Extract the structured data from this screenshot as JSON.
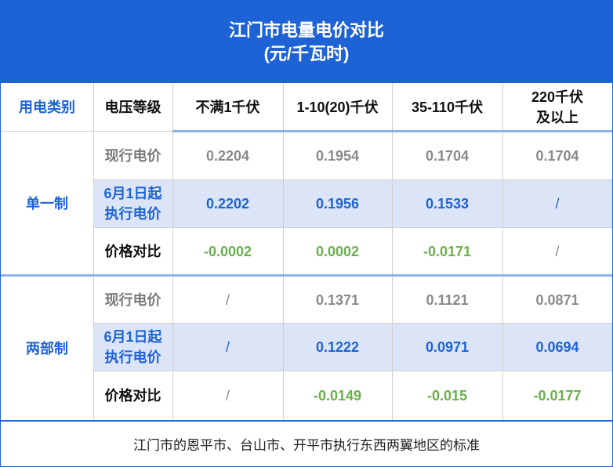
{
  "title": {
    "line1": "江门市电量电价对比",
    "line2": "(元/千瓦时)"
  },
  "header": {
    "category": "用电类别",
    "voltage": "电压等级",
    "col1": "不满1千伏",
    "col2": "1-10(20)千伏",
    "col3": "35-110千伏",
    "col4_line1": "220千伏",
    "col4_line2": "及以上"
  },
  "groups": [
    {
      "name": "单一制",
      "rows": [
        {
          "label": "现行电价",
          "values": [
            "0.2204",
            "0.1954",
            "0.1704",
            "0.1704"
          ]
        },
        {
          "label_line1": "6月1日起",
          "label_line2": "执行电价",
          "values": [
            "0.2202",
            "0.1956",
            "0.1533",
            "/"
          ]
        },
        {
          "label": "价格对比",
          "values": [
            "-0.0002",
            "0.0002",
            "-0.0171",
            "/"
          ]
        }
      ]
    },
    {
      "name": "两部制",
      "rows": [
        {
          "label": "现行电价",
          "values": [
            "/",
            "0.1371",
            "0.1121",
            "0.0871"
          ]
        },
        {
          "label_line1": "6月1日起",
          "label_line2": "执行电价",
          "values": [
            "/",
            "0.1222",
            "0.0971",
            "0.0694"
          ]
        },
        {
          "label": "价格对比",
          "values": [
            "/",
            "-0.0149",
            "-0.015",
            "-0.0177"
          ]
        }
      ]
    }
  ],
  "footer": "江门市的恩平市、台山市、开平市执行东西两翼地区的标准",
  "colors": {
    "brand_blue": "#1e63d6",
    "band": "#dbe5f7",
    "green": "#6ab04c",
    "gray": "#8a8a8a"
  }
}
